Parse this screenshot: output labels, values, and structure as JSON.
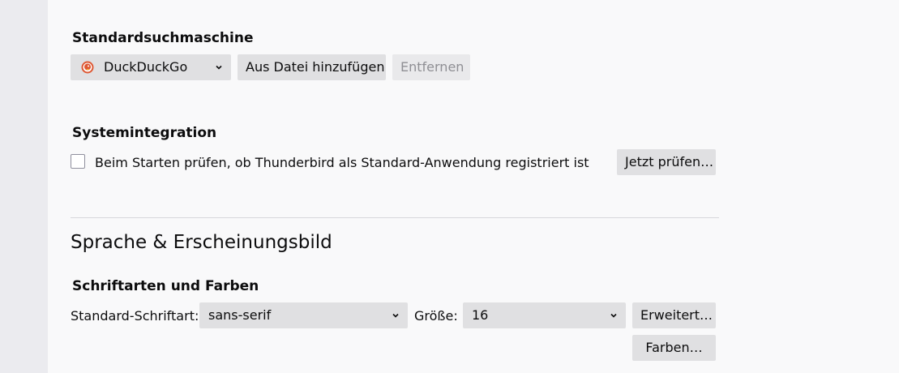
{
  "search": {
    "heading": "Standardsuchmaschine",
    "engine_selected": "DuckDuckGo",
    "engine_icon": "duckduckgo-icon",
    "add_from_file_button": "Aus Datei hinzufügen",
    "remove_button": "Entfernen"
  },
  "system_integration": {
    "heading": "Systemintegration",
    "check_on_startup_label": "Beim Starten prüfen, ob Thunderbird als Standard-Anwendung registriert ist",
    "check_now_button": "Jetzt prüfen…"
  },
  "language_appearance": {
    "heading": "Sprache & Erscheinungsbild",
    "fonts_colors_heading": "Schriftarten und Farben",
    "default_font_label": "Standard-Schriftart:",
    "default_font_value": "sans-serif",
    "size_label": "Größe:",
    "size_value": "16",
    "advanced_button": "Erweitert…",
    "colors_button": "Farben…"
  },
  "colors": {
    "accent": "#0060df",
    "disabled_text": "#8f8f94",
    "button_bg": "#e0e0e2"
  }
}
